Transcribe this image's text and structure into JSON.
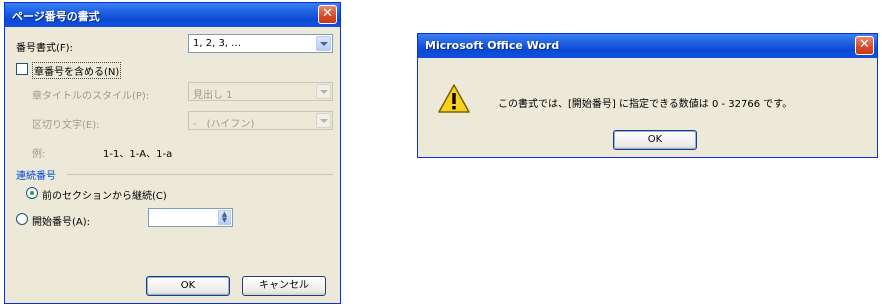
{
  "page_format_dialog": {
    "title": "ページ番号の書式",
    "number_format_label": "番号書式(F):",
    "number_format_value": "1, 2, 3, …",
    "include_chapter_label": "章番号を含める(N)",
    "chapter_style_label": "章タイトルのスタイル(P):",
    "chapter_style_value": "見出し 1",
    "separator_label": "区切り文字(E):",
    "separator_value": "-　(ハイフン)",
    "example_label": "例:",
    "example_value": "1-1、1-A、1-a",
    "numbering_section_label": "連続番号",
    "continue_label": "前のセクションから継続(C)",
    "start_at_label": "開始番号(A):",
    "start_at_value": "",
    "ok_label": "OK",
    "cancel_label": "キャンセル"
  },
  "message_box": {
    "title": "Microsoft Office Word",
    "message": "この書式では、[開始番号] に指定できる数値は 0 - 32766 です。",
    "ok_label": "OK",
    "icon": "warning-icon"
  },
  "colors": {
    "title_bar": "#0a48d6",
    "dialog_face": "#ece9d8",
    "close_button": "#d8492a"
  }
}
